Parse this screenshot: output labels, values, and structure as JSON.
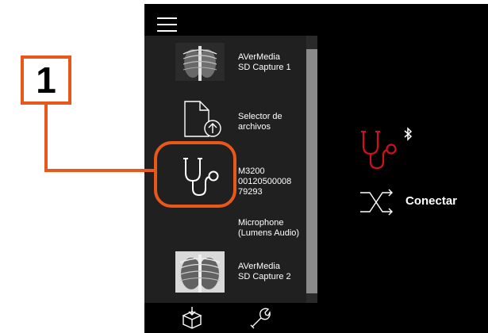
{
  "devices": [
    {
      "label_line1": "AVerMedia",
      "label_line2": "SD Capture 1",
      "icon": "xray-thumbnail"
    },
    {
      "label_line1": "Selector de",
      "label_line2": "archivos",
      "icon": "file-upload-icon"
    },
    {
      "label_line1": "M3200",
      "label_line2": "00120500008",
      "label_line3": "79293",
      "icon": "stethoscope-icon"
    },
    {
      "label_line1": "Microphone",
      "label_line2": "(Lumens Audio)",
      "icon": "microphone"
    },
    {
      "label_line1": "AVerMedia",
      "label_line2": "SD Capture 2",
      "icon": "xray-thumbnail"
    }
  ],
  "callout": {
    "number": "1"
  },
  "status": {
    "connect_label": "Conectar"
  },
  "colors": {
    "accent": "#e8581a",
    "stethoscope_active": "#d01020"
  },
  "footer": {
    "icons": [
      "package-import-icon",
      "wrench-icon"
    ]
  }
}
